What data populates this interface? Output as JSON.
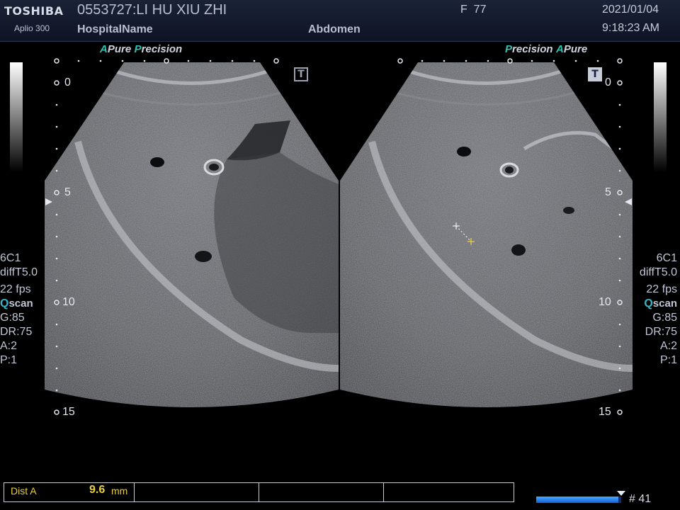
{
  "header": {
    "brand": "TOSHIBA",
    "model": "Aplio 300",
    "patient": "0553727:LI HU XIU ZHI",
    "hospital": "HospitalName",
    "preset": "Abdomen",
    "frequency": "F  77",
    "date": "2021/01/04",
    "time": "9:18:23 AM"
  },
  "left_panel": {
    "badge_a": "A",
    "badge_pure": "Pure",
    "badge_p": "P",
    "badge_precision": "recision"
  },
  "right_panel": {
    "badge_p": "P",
    "badge_precision": "recision",
    "badge_a": "A",
    "badge_pure": "Pure"
  },
  "depth_marks": [
    "0",
    "5",
    "10",
    "15"
  ],
  "tbox_label": "T",
  "params_left": {
    "probe": "6C1",
    "mode": "diffT5.0",
    "fps": "22 fps",
    "qscan_q": "Q",
    "qscan": "scan",
    "gain": "G:85",
    "dr": "DR:75",
    "a": "A:2",
    "p": "P:1"
  },
  "params_right": {
    "probe": "6C1",
    "mode": "diffT5.0",
    "fps": "22 fps",
    "qscan_q": "Q",
    "qscan": "scan",
    "gain": "G:85",
    "dr": "DR:75",
    "a": "A:2",
    "p": "P:1"
  },
  "measurement": {
    "label": "Dist A",
    "value": "9.6",
    "unit": "mm"
  },
  "cine": {
    "frame": "# 41",
    "progress": 0.97
  },
  "colors": {
    "accent": "#33c0b0",
    "measurement": "#e8d040",
    "header_bg": "#141c2e"
  }
}
